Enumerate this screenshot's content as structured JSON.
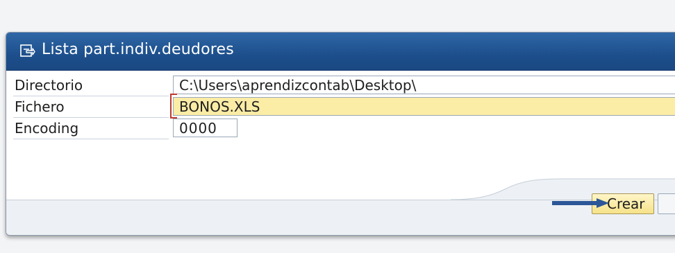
{
  "dialog": {
    "title": "Lista part.indiv.deudores",
    "title_icon": "execute-arrow-icon"
  },
  "form": {
    "rows": [
      {
        "label": "Directorio",
        "value": "C:\\Users\\aprendizcontab\\Desktop\\"
      },
      {
        "label": "Fichero",
        "value": "BONOS.XLS"
      },
      {
        "label": "Encoding",
        "value": "0000"
      }
    ]
  },
  "buttons": {
    "crear_label": "Crear"
  },
  "colors": {
    "titlebar": "#1d4f8c",
    "required_field": "#fbeca6",
    "button": "#f6e28a",
    "annotation_arrow": "#2c5698"
  },
  "annotation": {
    "icon": "right-arrow-annotation"
  }
}
